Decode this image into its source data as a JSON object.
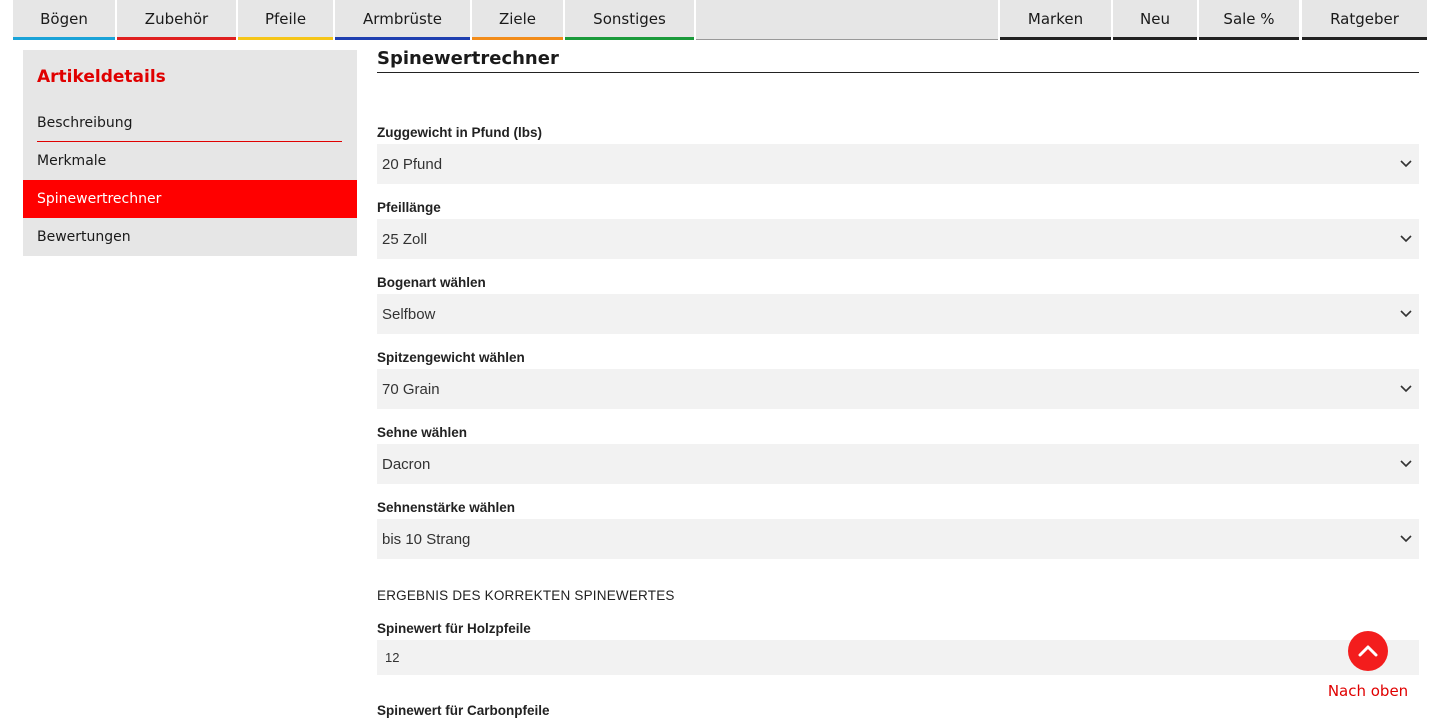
{
  "nav": {
    "left_items": [
      {
        "label": "Bögen",
        "color": "#1aa3d8"
      },
      {
        "label": "Zubehör",
        "color": "#e02020"
      },
      {
        "label": "Pfeile",
        "color": "#f5c518"
      },
      {
        "label": "Armbrüste",
        "color": "#1f3fb0"
      },
      {
        "label": "Ziele",
        "color": "#f28c1a"
      },
      {
        "label": "Sonstiges",
        "color": "#1a9a3a"
      }
    ],
    "right_items": [
      {
        "label": "Marken"
      },
      {
        "label": "Neu"
      },
      {
        "label": "Sale %"
      },
      {
        "label": "Ratgeber"
      }
    ]
  },
  "sidebar": {
    "title": "Artikeldetails",
    "items": [
      {
        "label": "Beschreibung"
      },
      {
        "label": "Merkmale"
      },
      {
        "label": "Spinewertrechner",
        "active": true
      },
      {
        "label": "Bewertungen"
      }
    ]
  },
  "main": {
    "title": "Spinewertrechner",
    "fields": [
      {
        "label": "Zuggewicht in Pfund (lbs)",
        "value": "20 Pfund"
      },
      {
        "label": "Pfeillänge",
        "value": "25 Zoll"
      },
      {
        "label": "Bogenart wählen",
        "value": "Selfbow"
      },
      {
        "label": "Spitzengewicht wählen",
        "value": "70 Grain"
      },
      {
        "label": "Sehne wählen",
        "value": "Dacron"
      },
      {
        "label": "Sehnenstärke wählen",
        "value": "bis 10 Strang"
      }
    ],
    "result_heading": "ERGEBNIS DES KORREKTEN SPINEWERTES",
    "wood_label": "Spinewert für Holzpfeile",
    "wood_value": "12",
    "carbon_label": "Spinewert für Carbonpfeile"
  },
  "to_top": {
    "label": "Nach oben"
  },
  "colors": {
    "accent": "#ff0000",
    "panel": "#e6e6e6",
    "field": "#f2f2f2"
  }
}
